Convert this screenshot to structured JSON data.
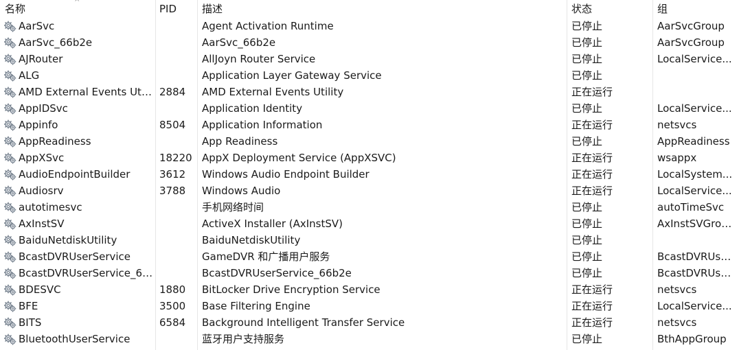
{
  "columns": {
    "name": "名称",
    "pid": "PID",
    "desc": "描述",
    "status": "状态",
    "group": "组"
  },
  "sort_indicator": "^",
  "services": [
    {
      "name": "AarSvc",
      "pid": "",
      "desc": "Agent Activation Runtime",
      "status": "已停止",
      "group": "AarSvcGroup"
    },
    {
      "name": "AarSvc_66b2e",
      "pid": "",
      "desc": "AarSvc_66b2e",
      "status": "已停止",
      "group": "AarSvcGroup"
    },
    {
      "name": "AJRouter",
      "pid": "",
      "desc": "AllJoyn Router Service",
      "status": "已停止",
      "group": "LocalService..."
    },
    {
      "name": "ALG",
      "pid": "",
      "desc": "Application Layer Gateway Service",
      "status": "已停止",
      "group": ""
    },
    {
      "name": "AMD External Events Utili...",
      "pid": "2884",
      "desc": "AMD External Events Utility",
      "status": "正在运行",
      "group": ""
    },
    {
      "name": "AppIDSvc",
      "pid": "",
      "desc": "Application Identity",
      "status": "已停止",
      "group": "LocalService..."
    },
    {
      "name": "Appinfo",
      "pid": "8504",
      "desc": "Application Information",
      "status": "正在运行",
      "group": "netsvcs"
    },
    {
      "name": "AppReadiness",
      "pid": "",
      "desc": "App Readiness",
      "status": "已停止",
      "group": "AppReadiness"
    },
    {
      "name": "AppXSvc",
      "pid": "18220",
      "desc": "AppX Deployment Service (AppXSVC)",
      "status": "正在运行",
      "group": "wsappx"
    },
    {
      "name": "AudioEndpointBuilder",
      "pid": "3612",
      "desc": "Windows Audio Endpoint Builder",
      "status": "正在运行",
      "group": "LocalSystem..."
    },
    {
      "name": "Audiosrv",
      "pid": "3788",
      "desc": "Windows Audio",
      "status": "正在运行",
      "group": "LocalService..."
    },
    {
      "name": "autotimesvc",
      "pid": "",
      "desc": "手机网络时间",
      "status": "已停止",
      "group": "autoTimeSvc"
    },
    {
      "name": "AxInstSV",
      "pid": "",
      "desc": "ActiveX Installer (AxInstSV)",
      "status": "已停止",
      "group": "AxInstSVGroup"
    },
    {
      "name": "BaiduNetdiskUtility",
      "pid": "",
      "desc": "BaiduNetdiskUtility",
      "status": "已停止",
      "group": ""
    },
    {
      "name": "BcastDVRUserService",
      "pid": "",
      "desc": "GameDVR 和广播用户服务",
      "status": "已停止",
      "group": "BcastDVRUse..."
    },
    {
      "name": "BcastDVRUserService_66...",
      "pid": "",
      "desc": "BcastDVRUserService_66b2e",
      "status": "已停止",
      "group": "BcastDVRUse..."
    },
    {
      "name": "BDESVC",
      "pid": "1880",
      "desc": "BitLocker Drive Encryption Service",
      "status": "正在运行",
      "group": "netsvcs"
    },
    {
      "name": "BFE",
      "pid": "3500",
      "desc": "Base Filtering Engine",
      "status": "正在运行",
      "group": "LocalService..."
    },
    {
      "name": "BITS",
      "pid": "6584",
      "desc": "Background Intelligent Transfer Service",
      "status": "正在运行",
      "group": "netsvcs"
    },
    {
      "name": "BluetoothUserService",
      "pid": "",
      "desc": "蓝牙用户支持服务",
      "status": "已停止",
      "group": "BthAppGroup"
    }
  ],
  "icon": "service-gears-icon"
}
